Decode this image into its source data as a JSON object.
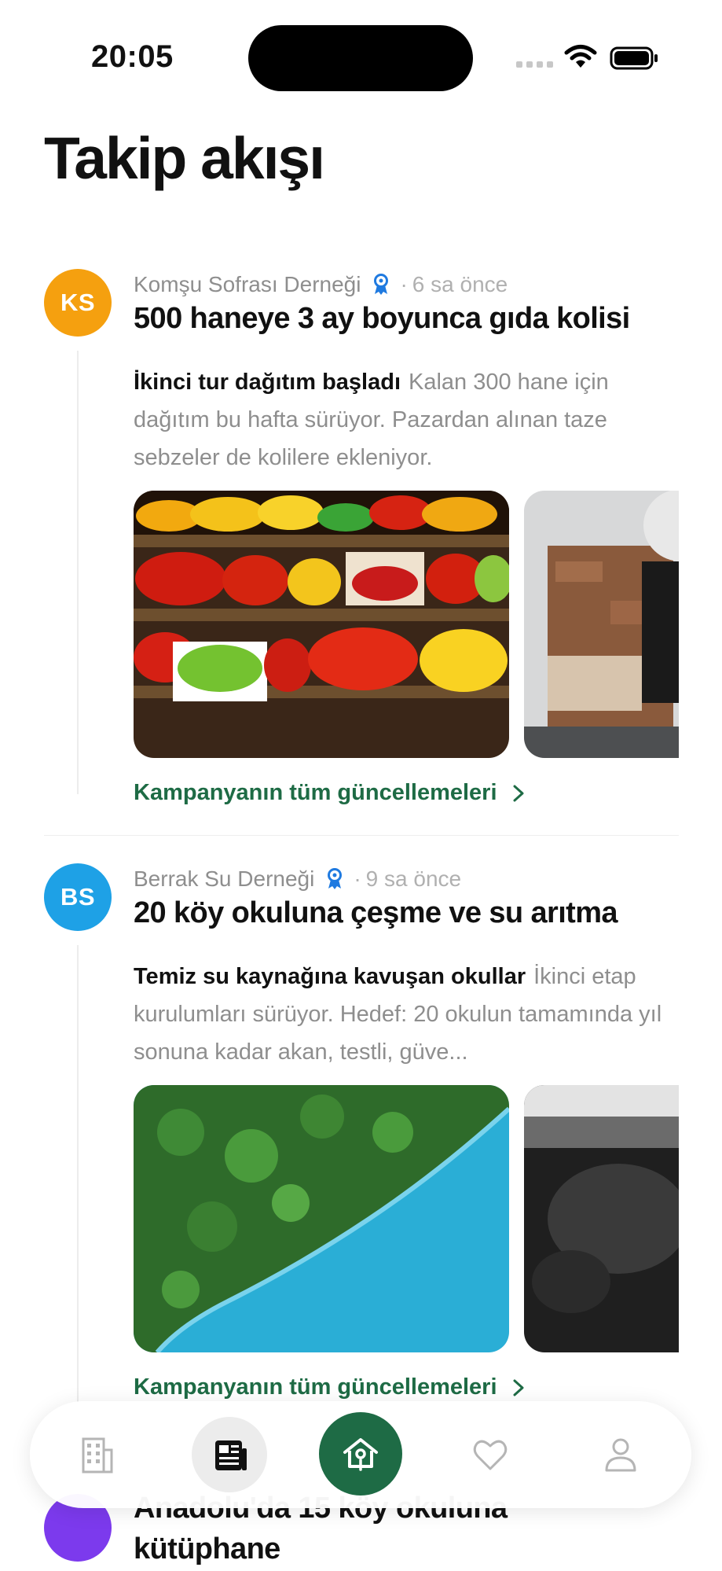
{
  "status_bar": {
    "time": "20:05"
  },
  "page": {
    "title": "Takip akışı"
  },
  "posts": [
    {
      "avatar": "KS",
      "avatar_color": "#f5a00f",
      "org": "Komşu Sofrası Derneği",
      "dot": "·",
      "time_ago": "6 sa önce",
      "title": "500 haneye 3 ay boyunca gıda kolisi",
      "lead": "İkinci tur dağıtım başladı",
      "body": "Kalan 300 hane için dağıtım bu hafta sürüyor. Pazardan alınan taze sebzeler de kolilere ekleniyor.",
      "link": "Kampanyanın tüm güncellemeleri"
    },
    {
      "avatar": "BS",
      "avatar_color": "#1ea1e6",
      "org": "Berrak Su Derneği",
      "dot": "·",
      "time_ago": "9 sa önce",
      "title": "20 köy okuluna çeşme ve su arıtma",
      "lead": "Temiz su kaynağına kavuşan okullar",
      "body": "İkinci etap kurulumları sürüyor. Hedef: 20 okulun tamamında yıl sonuna kadar akan, testli, güve...",
      "link": "Kampanyanın tüm güncellemeleri"
    },
    {
      "avatar_color": "#7c3aed",
      "title": "Anadolu'da 15 köy okuluna kütüphane"
    }
  ],
  "tab_bar": {
    "items": [
      "building-icon",
      "newspaper-icon",
      "birdhouse-icon",
      "heart-icon",
      "person-icon"
    ],
    "active": "newspaper-icon",
    "accent": "#1e6b45"
  },
  "colors": {
    "verified": "#1f7ae0",
    "link": "#1e6b45"
  }
}
